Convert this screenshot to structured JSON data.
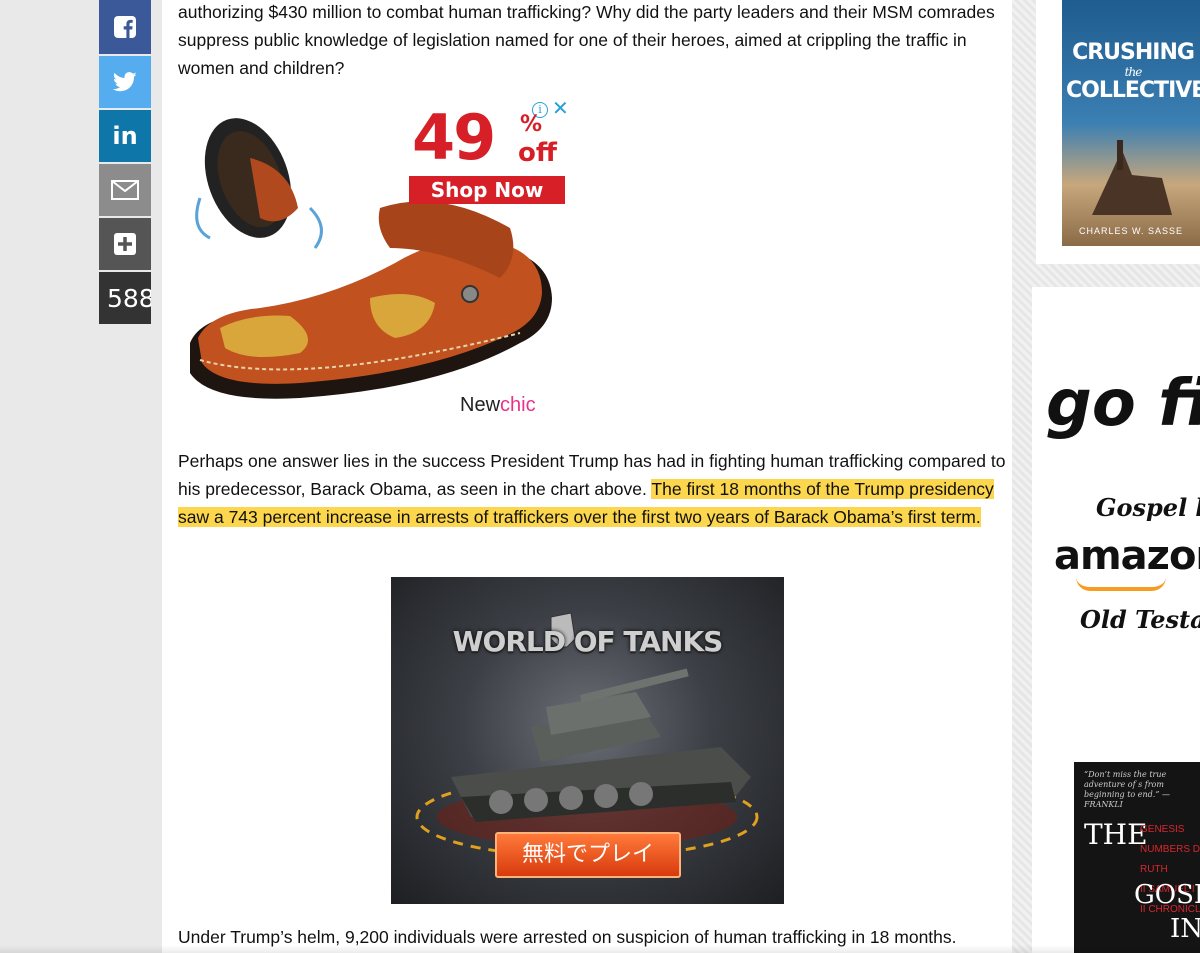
{
  "share": {
    "count": "588",
    "icons": [
      "facebook-icon",
      "twitter-icon",
      "linkedin-icon",
      "email-icon",
      "plus-icon"
    ]
  },
  "article": {
    "para1": "authorizing $430 million to combat human trafficking? Why did the party leaders and their MSM comrades suppress public knowledge of legislation named for one of their heroes, aimed at crippling the traffic in women and children?",
    "para2_plain": "Perhaps one answer lies in the success President Trump has had in fighting human trafficking compared to his predecessor, Barack Obama, as seen in the chart above. ",
    "para2_highlight": "The first 18 months of the Trump presidency saw a 743 percent increase in arrests of traffickers over the first two years of Barack Obama’s first term.",
    "para3": "Under Trump’s helm, 9,200 individuals were arrested on suspicion of human trafficking in 18 months."
  },
  "shoe_ad": {
    "discount": "49",
    "percent_symbol": "%",
    "off_label": "off",
    "cta": "Shop Now",
    "brand_part1": "New",
    "brand_part2": "chic",
    "close": "✕",
    "info": "i"
  },
  "tank_ad": {
    "logo": "WORLD OF TANKS",
    "cta": "無料でプレイ"
  },
  "sidebar": {
    "book1_title_a": "CRUSHING",
    "book1_title_the": "the",
    "book1_title_b": "COLLECTIVE",
    "book1_author": "CHARLES W. SASSE",
    "promo_line1": "go fi",
    "promo_line2": "Gospel b",
    "promo_amazon": "amazor",
    "promo_line3": "Old Testan",
    "book2_quote": "“Don’t miss the true adventure of s from beginning to end.” —FRANKLI",
    "book2_the": "THE",
    "book2_list": "GENESIS\nNUMBERS DEUTERON\nRUTH\nII SAMUEL I KINGS II\nII CHRONICLES",
    "book2_gospel": "GOSPE",
    "book2_in": "IN"
  },
  "colors": {
    "facebook": "#3b5998",
    "twitter": "#55acee",
    "linkedin": "#0e76a8",
    "highlight": "#fcd64d",
    "ad_red": "#d61f26"
  }
}
